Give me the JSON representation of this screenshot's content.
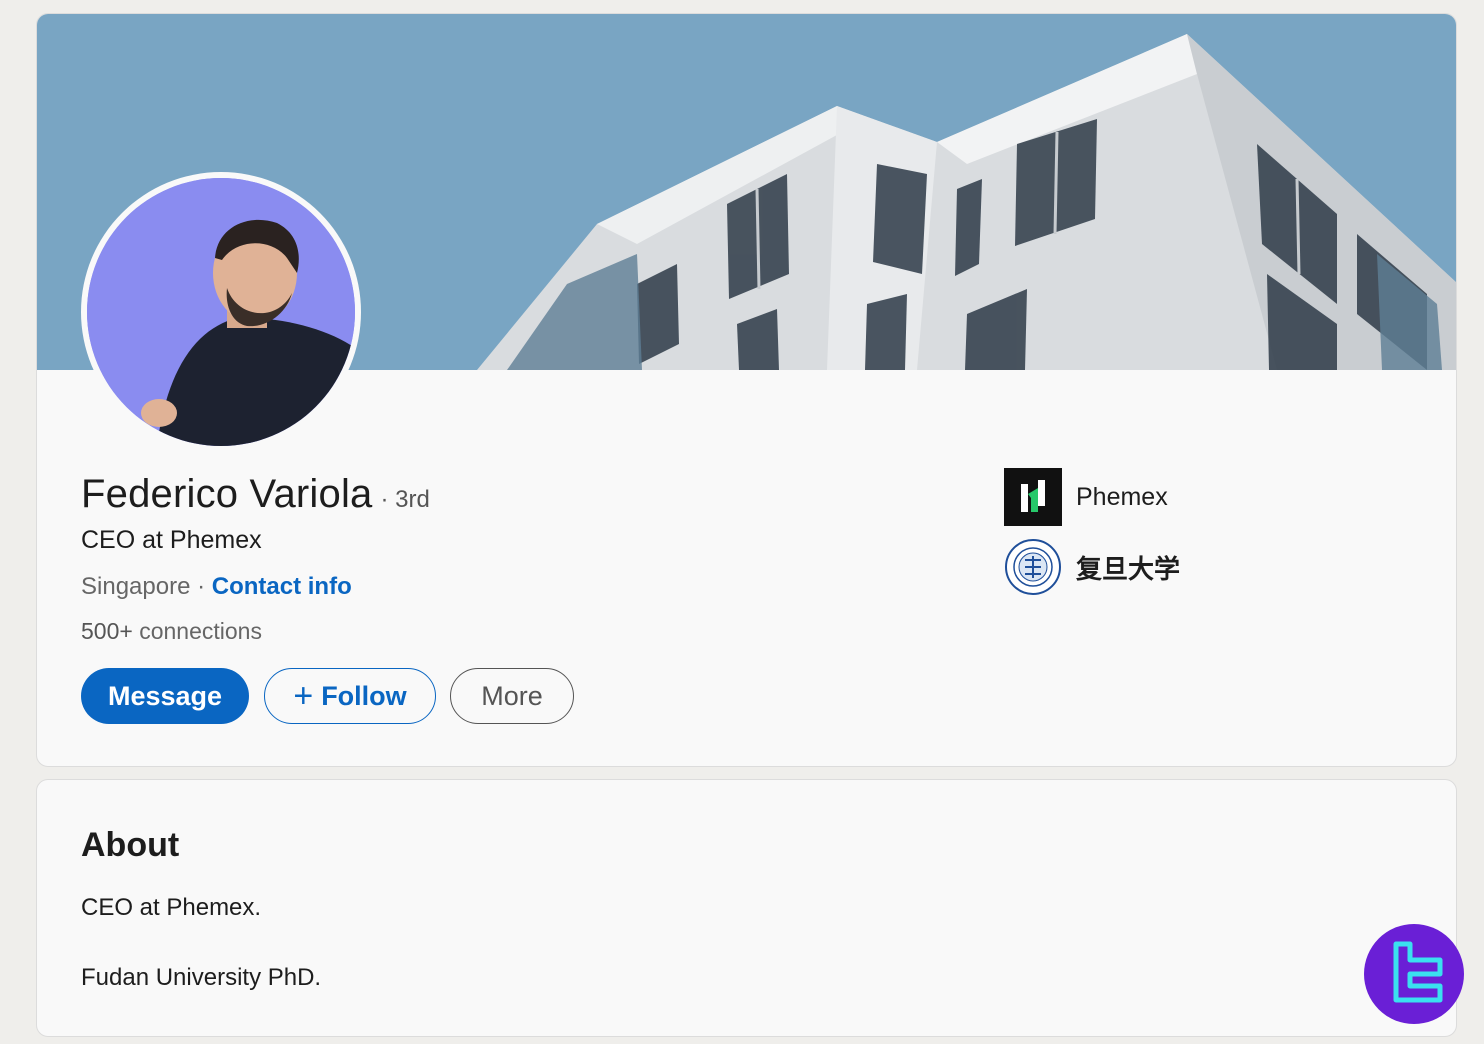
{
  "profile": {
    "name": "Federico Variola",
    "degree": "· 3rd",
    "headline": "CEO at Phemex",
    "location": "Singapore ·",
    "contact_info": "Contact info",
    "connections_count": "500+",
    "connections_label": "connections"
  },
  "actions": {
    "message": "Message",
    "follow": "Follow",
    "more": "More"
  },
  "organizations": [
    {
      "name": "Phemex",
      "icon": "phemex-logo"
    },
    {
      "name": "复旦大学",
      "icon": "fudan-university-seal"
    }
  ],
  "about": {
    "title": "About",
    "line1": "CEO at Phemex.",
    "line2": "Fudan University PhD."
  },
  "colors": {
    "accent": "#0a66c2",
    "card_bg": "#f9f9f9",
    "page_bg": "#efeeeb",
    "banner_sky": "#7aa6c4",
    "watermark": "#6a1fd6"
  }
}
